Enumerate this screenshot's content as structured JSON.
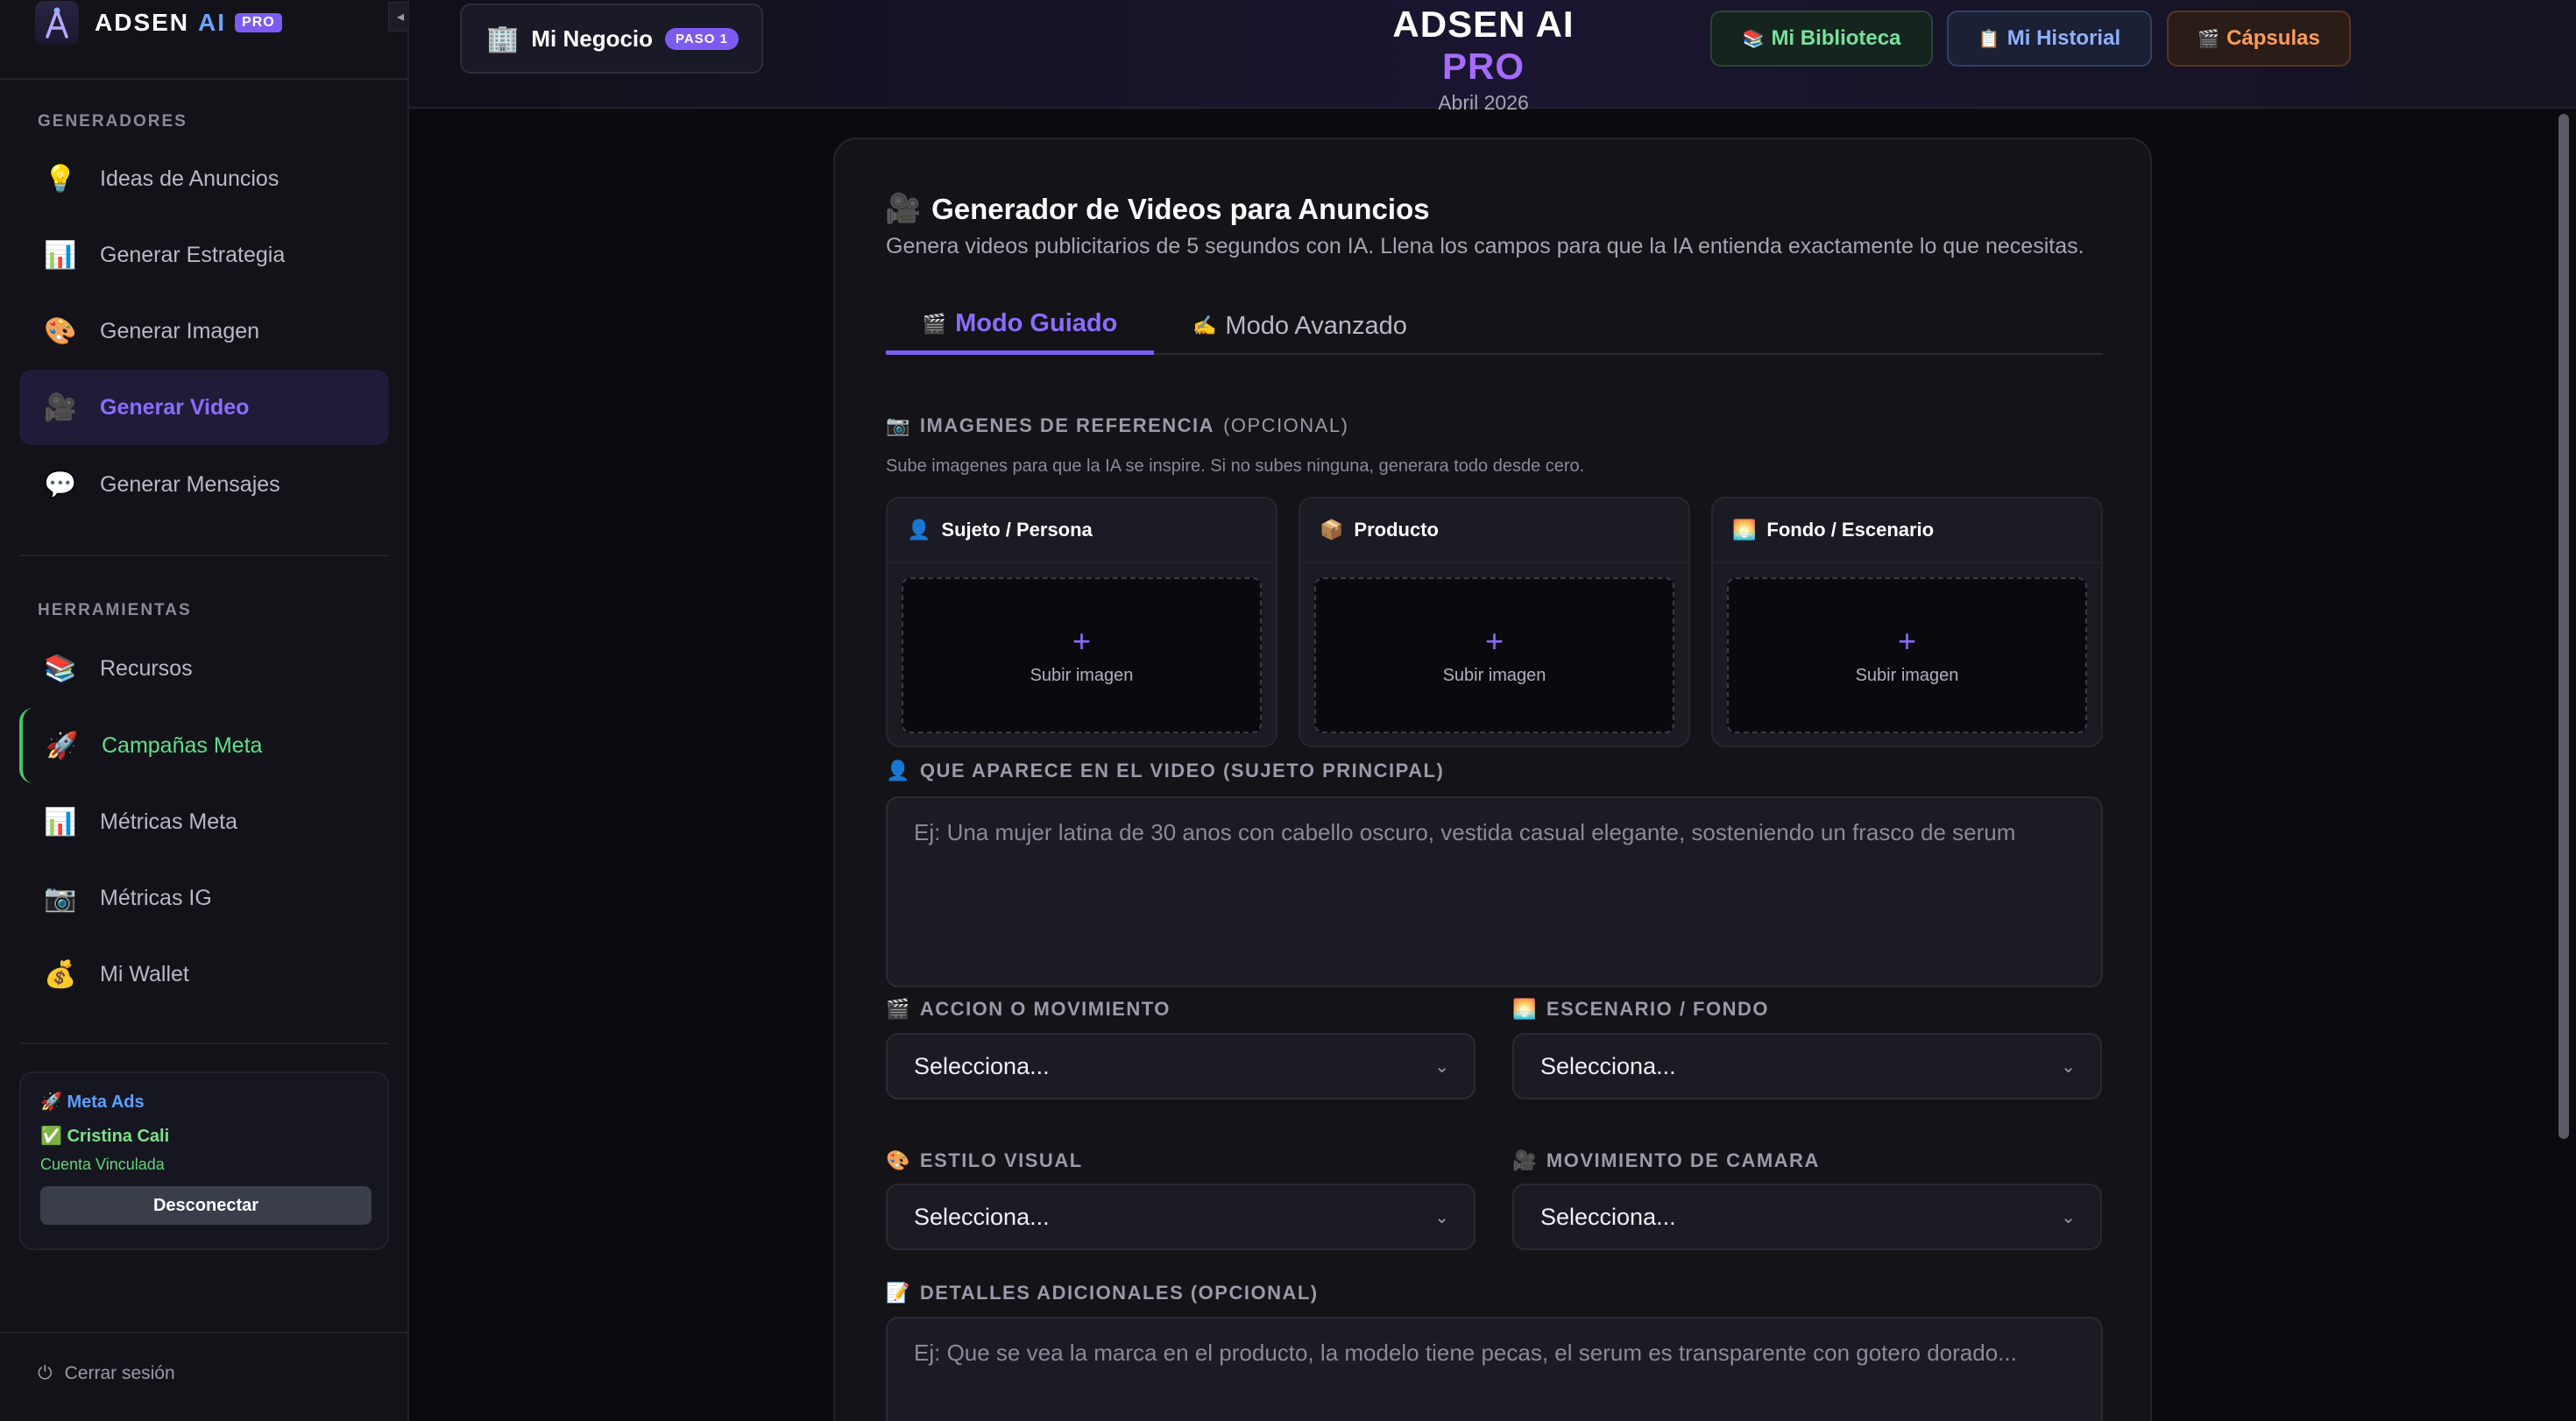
{
  "brand": {
    "name": "ADSEN",
    "ai": "AI",
    "badge": "PRO",
    "collapse": "◂"
  },
  "sidebar": {
    "generators_title": "GENERADORES",
    "generators": [
      {
        "icon": "💡",
        "label": "Ideas de Anuncios"
      },
      {
        "icon": "📊",
        "label": "Generar Estrategia"
      },
      {
        "icon": "🎨",
        "label": "Generar Imagen"
      },
      {
        "icon": "🎥",
        "label": "Generar Video"
      },
      {
        "icon": "💬",
        "label": "Generar Mensajes"
      }
    ],
    "tools_title": "HERRAMIENTAS",
    "tools": [
      {
        "icon": "📚",
        "label": "Recursos"
      },
      {
        "icon": "🚀",
        "label": "Campañas Meta"
      },
      {
        "icon": "📊",
        "label": "Métricas Meta"
      },
      {
        "icon": "📷",
        "label": "Métricas IG"
      },
      {
        "icon": "💰",
        "label": "Mi Wallet"
      }
    ],
    "meta_card": {
      "title": "🚀 Meta Ads",
      "user": "✅ Cristina Cali",
      "status": "Cuenta Vinculada",
      "button": "Desconectar"
    },
    "logout": {
      "icon": "⏻",
      "label": "Cerrar sesión"
    }
  },
  "topbar": {
    "business": {
      "icon": "🏢",
      "name": "Mi Negocio",
      "step": "PASO 1"
    },
    "title_main": "ADSEN AI",
    "title_pro": "PRO",
    "subtitle": "Abril 2026",
    "buttons": [
      {
        "icon": "📚",
        "label": "Mi Biblioteca"
      },
      {
        "icon": "📋",
        "label": "Mi Historial"
      },
      {
        "icon": "🎬",
        "label": "Cápsulas"
      }
    ]
  },
  "card": {
    "icon": "🎥",
    "title": "Generador de Videos para Anuncios",
    "subtitle": "Genera videos publicitarios de 5 segundos con IA. Llena los campos para que la IA entienda exactamente lo que necesitas.",
    "tabs": [
      {
        "icon": "🎬",
        "label": "Modo Guiado"
      },
      {
        "icon": "✍️",
        "label": "Modo Avanzado"
      }
    ],
    "ref_images": {
      "icon": "📷",
      "label": "IMAGENES DE REFERENCIA",
      "optional": "(OPCIONAL)",
      "help": "Sube imagenes para que la IA se inspire. Si no subes ninguna, generara todo desde cero.",
      "boxes": [
        {
          "icon": "👤",
          "label": "Sujeto / Persona",
          "plus": "+",
          "upload": "Subir imagen"
        },
        {
          "icon": "📦",
          "label": "Producto",
          "plus": "+",
          "upload": "Subir imagen"
        },
        {
          "icon": "🌅",
          "label": "Fondo / Escenario",
          "plus": "+",
          "upload": "Subir imagen"
        }
      ]
    },
    "subject": {
      "icon": "👤",
      "label": "QUE APARECE EN EL VIDEO (SUJETO PRINCIPAL)",
      "placeholder": "Ej: Una mujer latina de 30 anos con cabello oscuro, vestida casual elegante, sosteniendo un frasco de serum"
    },
    "selects": [
      {
        "icon": "🎬",
        "label": "ACCION O MOVIMIENTO",
        "value": "Selecciona..."
      },
      {
        "icon": "🌅",
        "label": "ESCENARIO / FONDO",
        "value": "Selecciona..."
      },
      {
        "icon": "🎨",
        "label": "ESTILO VISUAL",
        "value": "Selecciona..."
      },
      {
        "icon": "🎥",
        "label": "MOVIMIENTO DE CAMARA",
        "value": "Selecciona..."
      }
    ],
    "details": {
      "icon": "📝",
      "label": "DETALLES ADICIONALES (OPCIONAL)",
      "placeholder": "Ej: Que se vea la marca en el producto, la modelo tiene pecas, el serum es transparente con gotero dorado..."
    }
  }
}
